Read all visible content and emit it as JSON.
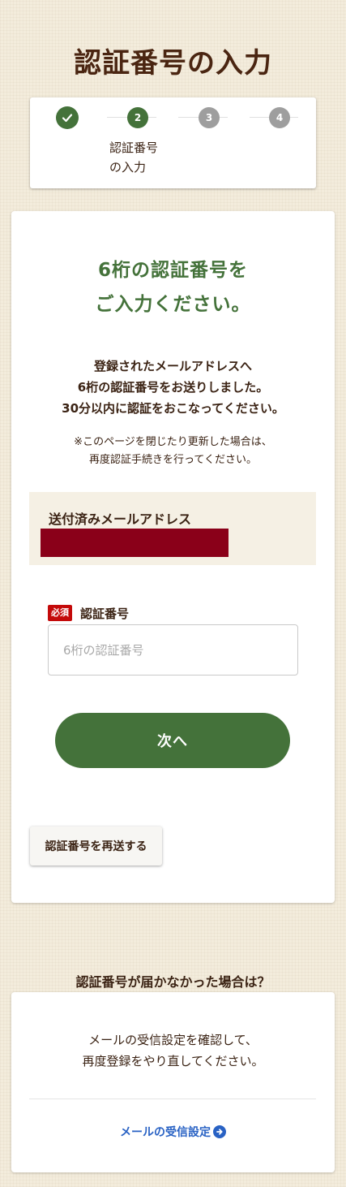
{
  "page": {
    "title": "認証番号の入力"
  },
  "stepper": {
    "steps": [
      {
        "number": "1",
        "status": "done"
      },
      {
        "number": "2",
        "status": "current"
      },
      {
        "number": "3",
        "status": "future"
      },
      {
        "number": "4",
        "status": "future"
      }
    ],
    "current_label_line1": "認証番号",
    "current_label_line2": "の入力"
  },
  "main": {
    "headline_line1": "6桁の認証番号を",
    "headline_line2": "ご入力ください。",
    "notice_line1": "登録されたメールアドレスへ",
    "notice_line2": "6桁の認証番号をお送りしました。",
    "notice_line3": "30分以内に認証をおこなってください。",
    "caution_line1": "※このページを閉じたり更新した場合は、",
    "caution_line2": "再度認証手続きを行ってください。",
    "sent_email_label": "送付済みメールアドレス",
    "sent_email_value": "",
    "required_badge": "必須",
    "code_field_label": "認証番号",
    "code_field_placeholder": "6桁の認証番号",
    "code_field_value": "",
    "next_button": "次へ",
    "resend_button": "認証番号を再送する"
  },
  "help": {
    "title": "認証番号が届かなかった場合は？",
    "text_line1": "メールの受信設定を確認して、",
    "text_line2": "再度登録をやり直してください。",
    "link_label": "メールの受信設定"
  },
  "colors": {
    "brand_green": "#44723a",
    "title_brown": "#4a2511",
    "required_red": "#c40a0a",
    "redacted": "#8a0019",
    "link_blue": "#2962c4",
    "background": "#f3ecdc"
  },
  "icons": {
    "step1": "check-icon",
    "help_link": "arrow-right-circle-icon"
  }
}
